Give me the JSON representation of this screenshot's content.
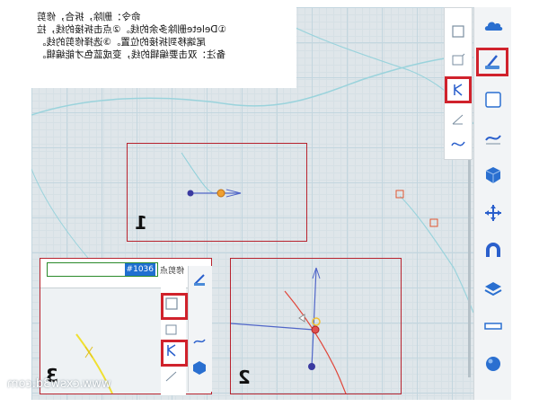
{
  "notes": {
    "line1": "命令：删除，拆合，修剪",
    "line2": "①Delete删除多余的线。②点击拆接的线，拉",
    "line3": "尾端移到拆接的位置。③选择修剪的线。",
    "line4": "备注：双击要编辑的线，变成蓝色才能编辑。"
  },
  "insets": {
    "one": "1",
    "two": "2",
    "three": "3"
  },
  "inset3": {
    "coord_label": "修剪点",
    "coord_value": "#1036"
  },
  "right_toolbar": {
    "items": [
      "cloud-icon",
      "sketch-pen-icon",
      "plane-icon",
      "surface-icon",
      "cube-icon",
      "move-icon",
      "magnet-icon",
      "layers-icon",
      "ruler-icon",
      "sphere-icon"
    ]
  },
  "sub_toolbar": {
    "items": [
      "rect-icon",
      "edit-rect-icon",
      "trim-icon",
      "slope-icon",
      "wave-icon"
    ]
  },
  "watermark": "www.cxsw3d.com",
  "colors": {
    "highlight": "#d0222c",
    "grid": "#c3d6df",
    "accent_blue": "#2a5fcc"
  }
}
